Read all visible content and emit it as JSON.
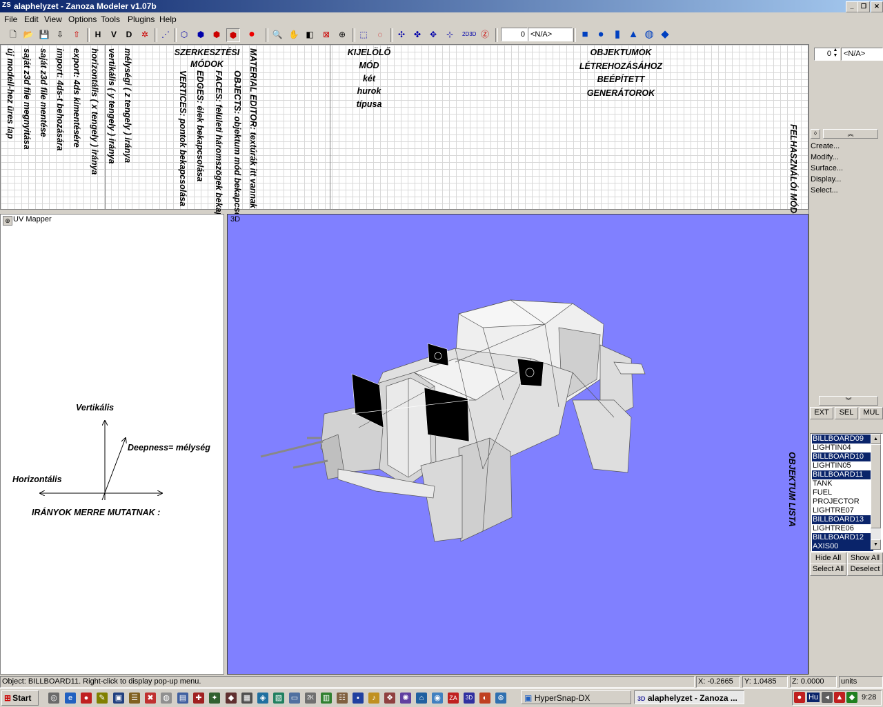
{
  "window": {
    "title": "alaphelyzet - Zanoza Modeler v1.07b"
  },
  "menu": [
    "File",
    "Edit",
    "View",
    "Options",
    "Tools",
    "Plugins",
    "Help"
  ],
  "toolbar": {
    "left_buttons": [
      "H",
      "V",
      "D"
    ],
    "combo_value": "<N/A>",
    "combo_number": "0"
  },
  "top_annotations": {
    "vertical_left": [
      "új modell-hez üres lap",
      "saját z3d file megnyitása",
      "saját z3d file mentése",
      "import: 4ds-t behozására",
      "export: 4ds kimentésére",
      "horizontális ( x tengely ) iránya",
      "vertikális ( y tengely ) iránya",
      "mélységi ( z tengely ) iránya"
    ],
    "edit_modes_title": [
      "SZERKESZTÉSI",
      "MÓDOK"
    ],
    "edit_modes": [
      "VERTICES: pontok bekapcsolása",
      "EDGES: élek bekapcsolása",
      "FACES: felületi háromszögek bekapcsolása",
      "OBJECTS: objektum mód bekapcsolása",
      "MATERIAL EDITOR: textúrák itt vannak"
    ],
    "selection": [
      "KIJELÖLŐ",
      "MÓD",
      "két",
      "hurok",
      "típusa"
    ],
    "objects": [
      "OBJEKTUMOK",
      "LÉTREHOZÁSÁHOZ",
      "BEÉPÍTETT",
      "GENERÁTOROK"
    ],
    "user_modes": "FELHASZNÁLÓI MÓDOK",
    "object_list_label": "OBJEKTUM LISTA"
  },
  "uv_mapper": {
    "title": "UV Mapper",
    "vertical": "Vertikális",
    "depth": "Deepness= mélység",
    "horizontal": "Horizontális",
    "caption": "IRÁNYOK MERRE MUTATNAK :"
  },
  "viewport": {
    "label": "3D",
    "background": "#8080ff"
  },
  "side_panel": {
    "spin_value": "0",
    "na_label": "<N/A>",
    "menu": [
      "Create...",
      "Modify...",
      "Surface...",
      "Display...",
      "Select..."
    ],
    "mode_buttons": [
      "EXT",
      "SEL",
      "MUL"
    ],
    "objects": [
      {
        "name": "BILLBOARD09",
        "selected": true
      },
      {
        "name": "LIGHTIN04",
        "selected": false
      },
      {
        "name": "BILLBOARD10",
        "selected": true
      },
      {
        "name": "LIGHTIN05",
        "selected": false
      },
      {
        "name": "BILLBOARD11",
        "selected": true
      },
      {
        "name": "TANK",
        "selected": false
      },
      {
        "name": "FUEL",
        "selected": false
      },
      {
        "name": "PROJECTOR",
        "selected": false
      },
      {
        "name": "LIGHTRE07",
        "selected": false
      },
      {
        "name": "BILLBOARD13",
        "selected": true
      },
      {
        "name": "LIGHTRE06",
        "selected": false
      },
      {
        "name": "BILLBOARD12",
        "selected": true
      },
      {
        "name": "AXIS00",
        "selected": true
      }
    ],
    "buttons": [
      "Hide All",
      "Show All",
      "Select All",
      "Deselect"
    ]
  },
  "status": {
    "message": "Object: BILLBOARD11. Right-click to display pop-up menu.",
    "x": "X: -0.2665",
    "y": "Y: 1.0485",
    "z": "Z: 0.0000",
    "units": "units"
  },
  "taskbar": {
    "start": "Start",
    "tasks": [
      "HyperSnap-DX",
      "alaphelyzet - Zanoza ..."
    ],
    "tray_lang": "Hu",
    "clock": "9:28"
  }
}
